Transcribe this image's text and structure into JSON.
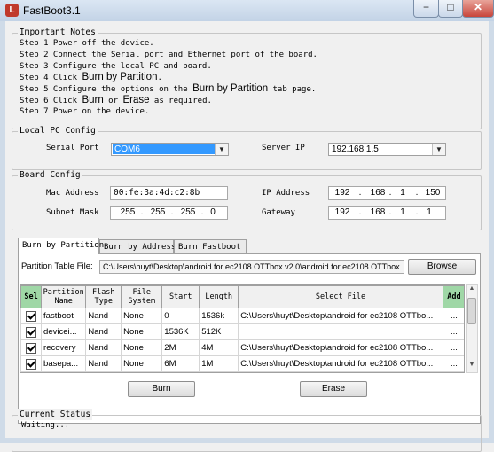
{
  "window": {
    "title": "FastBoot3.1",
    "icon_letter": "L",
    "minimize": "−",
    "maximize": "□",
    "close": "✕"
  },
  "notes": {
    "title": "Important Notes",
    "step1": "Step 1 Power off the device.",
    "step2": "Step 2 Connect the Serial port and Ethernet port of the board.",
    "step3": "Step 3 Configure the local PC and board.",
    "step4_prefix": "Step 4 Click ",
    "step4_bold": "Burn by Partition",
    "step4_suffix": ".",
    "step5_prefix": "Step 5 Configure the options on the ",
    "step5_bold": "Burn by Partition",
    "step5_suffix": " tab page.",
    "step6_prefix": "Step 6 Click ",
    "step6_bold1": "Burn",
    "step6_mid": " or ",
    "step6_bold2": "Erase",
    "step6_suffix": " as required.",
    "step7": "Step 7 Power on the device."
  },
  "local_pc": {
    "title": "Local PC Config",
    "serial_port_label": "Serial Port",
    "serial_port_value": "COM6",
    "server_ip_label": "Server IP",
    "server_ip_value": "192.168.1.5"
  },
  "board": {
    "title": "Board Config",
    "mac_label": "Mac Address",
    "mac_value": "00:fe:3a:4d:c2:8b",
    "ip_label": "IP Address",
    "ip": [
      "192",
      "168",
      "1",
      "150"
    ],
    "mask_label": "Subnet Mask",
    "mask": [
      "255",
      "255",
      "255",
      "0"
    ],
    "gateway_label": "Gateway",
    "gateway": [
      "192",
      "168",
      "1",
      "1"
    ],
    "dot": "."
  },
  "tabs": [
    "Burn by Partition",
    "Burn by Address",
    "Burn Fastboot"
  ],
  "partition": {
    "file_label": "Partition Table File:",
    "file_value": "C:\\Users\\huyt\\Desktop\\android for ec2108 OTTbox v2.0\\android for ec2108 OTTbox",
    "browse": "Browse",
    "headers": {
      "sel": "Sel",
      "name1": "Partition",
      "name2": "Name",
      "flash1": "Flash",
      "flash2": "Type",
      "fs1": "File",
      "fs2": "System",
      "start": "Start",
      "length": "Length",
      "file": "Select File",
      "add": "Add"
    },
    "rows": [
      {
        "name": "fastboot",
        "flash": "Nand",
        "fs": "None",
        "start": "0",
        "length": "1536k",
        "file": "C:\\Users\\huyt\\Desktop\\android for ec2108 OTTbo..."
      },
      {
        "name": "devicei...",
        "flash": "Nand",
        "fs": "None",
        "start": "1536K",
        "length": "512K",
        "file": ""
      },
      {
        "name": "recovery",
        "flash": "Nand",
        "fs": "None",
        "start": "2M",
        "length": "4M",
        "file": "C:\\Users\\huyt\\Desktop\\android for ec2108 OTTbo..."
      },
      {
        "name": "basepa...",
        "flash": "Nand",
        "fs": "None",
        "start": "6M",
        "length": "1M",
        "file": "C:\\Users\\huyt\\Desktop\\android for ec2108 OTTbo..."
      }
    ],
    "dots": "...",
    "burn": "Burn",
    "erase": "Erase"
  },
  "status": {
    "title": "Current Status",
    "text": "Waiting..."
  }
}
